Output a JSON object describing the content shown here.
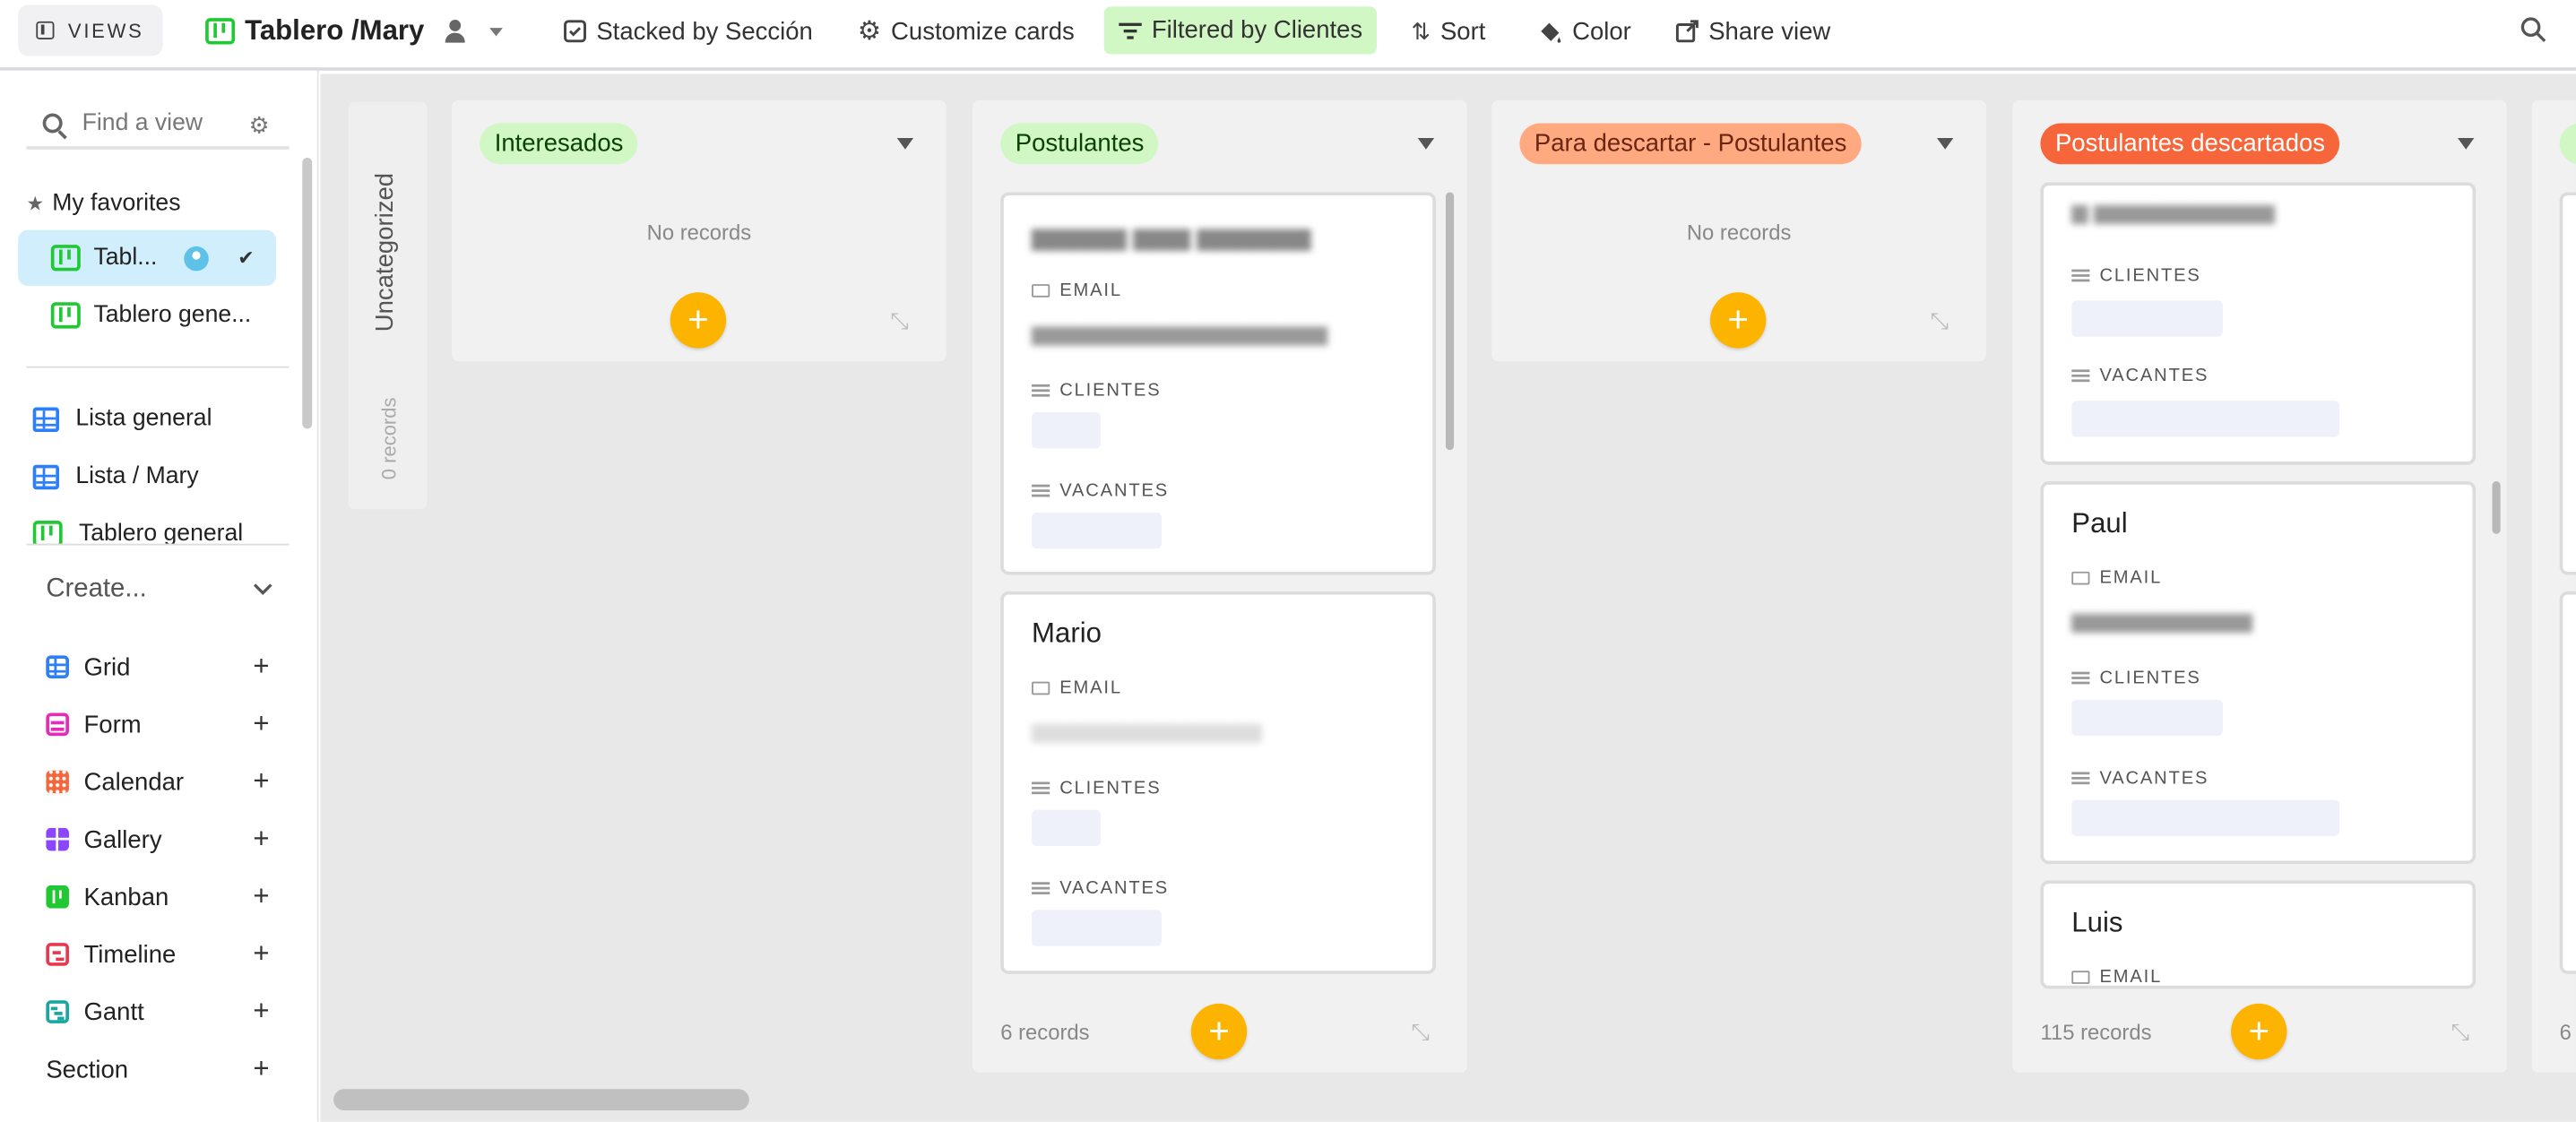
{
  "topbar": {
    "views_label": "VIEWS",
    "view_title": "Tablero /Mary",
    "stacked_label": "Stacked by Sección",
    "customize_label": "Customize cards",
    "filter_label": "Filtered by Clientes",
    "sort_label": "Sort",
    "color_label": "Color",
    "share_label": "Share view"
  },
  "sidebar": {
    "find_placeholder": "Find a view",
    "favorites_label": "My favorites",
    "favorites": [
      {
        "label": "Tabl..."
      },
      {
        "label": "Tablero gene..."
      }
    ],
    "views": [
      {
        "label": "Lista general",
        "icon": "grid-icon"
      },
      {
        "label": "Lista / Mary",
        "icon": "grid-icon"
      },
      {
        "label": "Tablero general",
        "icon": "kanban-icon"
      }
    ],
    "create_label": "Create...",
    "create_items": [
      {
        "label": "Grid",
        "color": "#2d7ff9"
      },
      {
        "label": "Form",
        "color": "#e929ba"
      },
      {
        "label": "Calendar",
        "color": "#f7653b"
      },
      {
        "label": "Gallery",
        "color": "#8b46ff"
      },
      {
        "label": "Kanban",
        "color": "#20c933"
      },
      {
        "label": "Timeline",
        "color": "#e8384f"
      },
      {
        "label": "Gantt",
        "color": "#18a7a1"
      },
      {
        "label": "Section",
        "color": ""
      }
    ]
  },
  "board": {
    "uncategorized": {
      "title": "Uncategorized",
      "count": "0 records"
    },
    "stacks": [
      {
        "title": "Interesados",
        "color": "#d1f7c4",
        "empty_label": "No records"
      },
      {
        "title": "Postulantes",
        "color": "#d1f7c4",
        "count": "6 records"
      },
      {
        "title": "Para descartar - Postulantes",
        "color": "#ffa981",
        "empty_label": "No records"
      },
      {
        "title": "Postulantes descartados",
        "color": "#f7653b",
        "count": "115 records"
      },
      {
        "count": "6"
      }
    ],
    "field_labels": {
      "email": "EMAIL",
      "clientes": "CLIENTES",
      "vacantes": "VACANTES"
    },
    "postulantes_cards": [
      {
        "name": "Mario"
      }
    ],
    "descartados_cards": [
      {
        "name": "Paul"
      },
      {
        "name": "Luis"
      }
    ]
  }
}
